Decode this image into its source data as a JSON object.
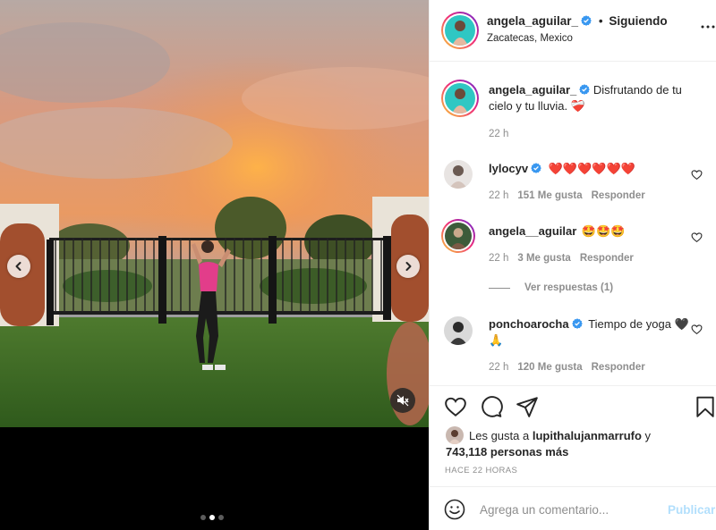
{
  "post": {
    "author": "angela_aguilar_",
    "separator": "•",
    "follow_status": "Siguiendo",
    "location": "Zacatecas, Mexico",
    "caption": "Disfrutando de tu cielo y tu lluvia. ❤️‍🩹",
    "caption_time": "22 h"
  },
  "comments": [
    {
      "user": "lylocyv",
      "verified": true,
      "text": "❤️❤️❤️❤️❤️❤️",
      "time": "22 h",
      "likes": "151 Me gusta",
      "reply": "Responder"
    },
    {
      "user": "angela__aguilar",
      "verified": false,
      "text": "🤩🤩🤩",
      "time": "22 h",
      "likes": "3 Me gusta",
      "reply": "Responder",
      "view_replies": "Ver respuestas (1)"
    },
    {
      "user": "ponchoarocha",
      "verified": true,
      "text": "Tiempo de yoga 🖤🙏",
      "time": "22 h",
      "likes": "120 Me gusta",
      "reply": "Responder"
    }
  ],
  "likes": {
    "prefix": "Les gusta a",
    "liker": "lupithalujanmarrufo",
    "connector": "y",
    "others": "743,118 personas más"
  },
  "timestamp": "HACE 22 HORAS",
  "add_comment": {
    "placeholder": "Agrega un comentario...",
    "publish_label": "Publicar"
  },
  "carousel": {
    "slides": 3,
    "active_index": 1
  },
  "icons": {
    "more": "more-options-icon",
    "like": "heart-icon",
    "comment": "comment-icon",
    "share": "share-icon",
    "save": "bookmark-icon",
    "emoji": "emoji-icon",
    "mute": "muted-speaker-icon",
    "prev": "chevron-left-icon",
    "next": "chevron-right-icon"
  },
  "colors": {
    "verified": "#3897f0",
    "link_disabled": "#b2dffc",
    "muted_text": "#8e8e8e"
  }
}
